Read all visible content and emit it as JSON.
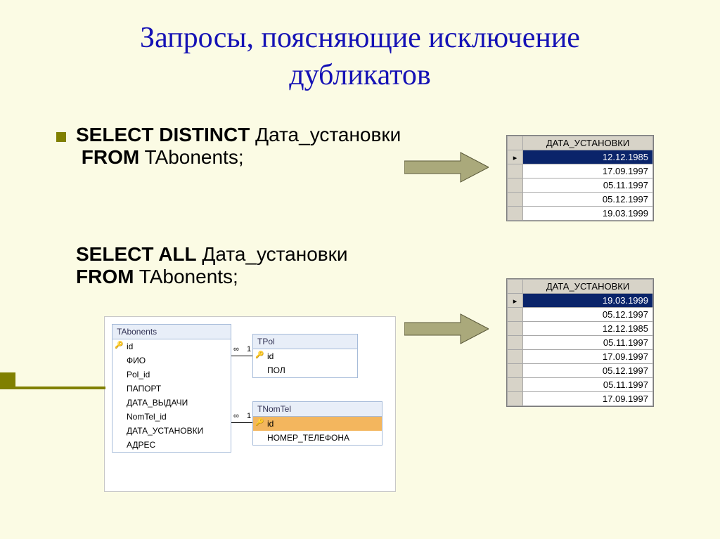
{
  "title_line1": "Запросы, поясняющие исключение",
  "title_line2": "дубликатов",
  "sql1": {
    "select": "SELECT DISTINCT",
    "col": " Дата_установки",
    "from": "FROM",
    "tbl": " TAbonents;"
  },
  "sql2": {
    "select": "SELECT ALL",
    "col": " Дата_установки",
    "from": "FROM",
    "tbl": " TAbonents;"
  },
  "grid_header": "ДАТА_УСТАНОВКИ",
  "grid1_rows": [
    "12.12.1985",
    "17.09.1997",
    "05.11.1997",
    "05.12.1997",
    "19.03.1999"
  ],
  "grid2_rows": [
    "19.03.1999",
    "05.12.1997",
    "12.12.1985",
    "05.11.1997",
    "17.09.1997",
    "05.12.1997",
    "05.11.1997",
    "17.09.1997"
  ],
  "diagram": {
    "tabonents": {
      "title": "TAbonents",
      "fields": [
        "id",
        "ФИО",
        "Pol_id",
        "ПАПОРТ",
        "ДАТА_ВЫДАЧИ",
        "NomTel_id",
        "ДАТА_УСТАНОВКИ",
        "АДРЕС"
      ]
    },
    "tpol": {
      "title": "TPol",
      "fields": [
        "id",
        "ПОЛ"
      ]
    },
    "tnomtel": {
      "title": "TNomTel",
      "fields": [
        "id",
        "НОМЕР_ТЕЛЕФОНА"
      ]
    },
    "cardinality_inf": "∞",
    "cardinality_one": "1"
  }
}
